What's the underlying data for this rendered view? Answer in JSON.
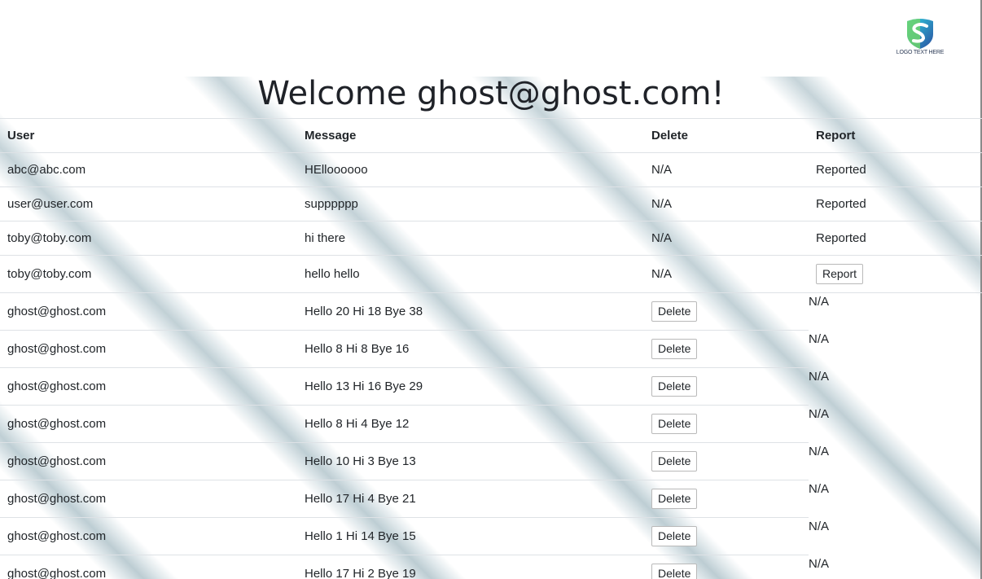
{
  "logo": {
    "icon": "shield-s-logo-icon",
    "text": "LOGO TEXT HERE",
    "colors": [
      "#1fb5d8",
      "#2a4fa0",
      "#6fd36a"
    ]
  },
  "page": {
    "title": "Welcome ghost@ghost.com!"
  },
  "table": {
    "headers": {
      "user": "User",
      "message": "Message",
      "delete": "Delete",
      "report": "Report"
    },
    "rows": [
      {
        "user": "abc@abc.com",
        "message": "HElloooooo",
        "delete": "N/A",
        "report": "Reported"
      },
      {
        "user": "user@user.com",
        "message": "supppppp",
        "delete": "N/A",
        "report": "Reported"
      },
      {
        "user": "toby@toby.com",
        "message": "hi there",
        "delete": "N/A",
        "report": "Reported"
      },
      {
        "user": "toby@toby.com",
        "message": "hello hello",
        "delete": "N/A",
        "report_button": "Report"
      },
      {
        "user": "ghost@ghost.com",
        "message": "Hello 20 Hi 18 Bye 38",
        "delete_button": "Delete",
        "report": "N/A"
      },
      {
        "user": "ghost@ghost.com",
        "message": "Hello 8 Hi 8 Bye 16",
        "delete_button": "Delete",
        "report": "N/A"
      },
      {
        "user": "ghost@ghost.com",
        "message": "Hello 13 Hi 16 Bye 29",
        "delete_button": "Delete",
        "report": "N/A"
      },
      {
        "user": "ghost@ghost.com",
        "message": "Hello 8 Hi 4 Bye 12",
        "delete_button": "Delete",
        "report": "N/A"
      },
      {
        "user": "ghost@ghost.com",
        "message": "Hello 10 Hi 3 Bye 13",
        "delete_button": "Delete",
        "report": "N/A"
      },
      {
        "user": "ghost@ghost.com",
        "message": "Hello 17 Hi 4 Bye 21",
        "delete_button": "Delete",
        "report": "N/A"
      },
      {
        "user": "ghost@ghost.com",
        "message": "Hello 1 Hi 14 Bye 15",
        "delete_button": "Delete",
        "report": "N/A"
      },
      {
        "user": "ghost@ghost.com",
        "message": "Hello 17 Hi 2 Bye 19",
        "delete_button": "Delete",
        "report": "N/A"
      }
    ]
  }
}
